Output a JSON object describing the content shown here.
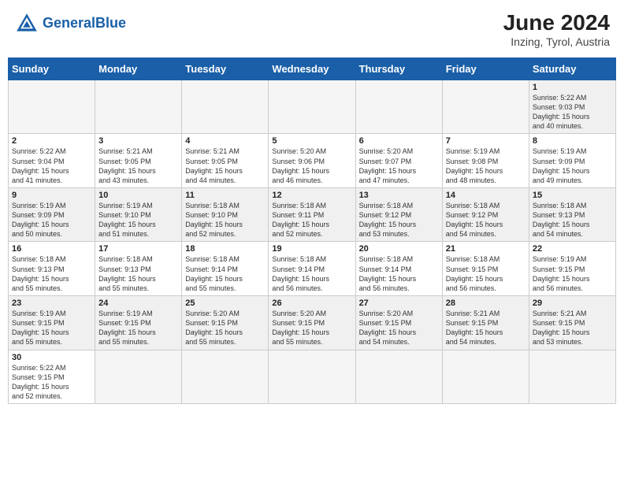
{
  "header": {
    "logo_general": "General",
    "logo_blue": "Blue",
    "month_title": "June 2024",
    "location": "Inzing, Tyrol, Austria"
  },
  "weekdays": [
    "Sunday",
    "Monday",
    "Tuesday",
    "Wednesday",
    "Thursday",
    "Friday",
    "Saturday"
  ],
  "days": [
    {
      "num": "",
      "info": "",
      "empty": true
    },
    {
      "num": "",
      "info": "",
      "empty": true
    },
    {
      "num": "",
      "info": "",
      "empty": true
    },
    {
      "num": "",
      "info": "",
      "empty": true
    },
    {
      "num": "",
      "info": "",
      "empty": true
    },
    {
      "num": "",
      "info": "",
      "empty": true
    },
    {
      "num": "1",
      "info": "Sunrise: 5:22 AM\nSunset: 9:03 PM\nDaylight: 15 hours\nand 40 minutes."
    },
    {
      "num": "2",
      "info": "Sunrise: 5:22 AM\nSunset: 9:04 PM\nDaylight: 15 hours\nand 41 minutes."
    },
    {
      "num": "3",
      "info": "Sunrise: 5:21 AM\nSunset: 9:05 PM\nDaylight: 15 hours\nand 43 minutes."
    },
    {
      "num": "4",
      "info": "Sunrise: 5:21 AM\nSunset: 9:05 PM\nDaylight: 15 hours\nand 44 minutes."
    },
    {
      "num": "5",
      "info": "Sunrise: 5:20 AM\nSunset: 9:06 PM\nDaylight: 15 hours\nand 46 minutes."
    },
    {
      "num": "6",
      "info": "Sunrise: 5:20 AM\nSunset: 9:07 PM\nDaylight: 15 hours\nand 47 minutes."
    },
    {
      "num": "7",
      "info": "Sunrise: 5:19 AM\nSunset: 9:08 PM\nDaylight: 15 hours\nand 48 minutes."
    },
    {
      "num": "8",
      "info": "Sunrise: 5:19 AM\nSunset: 9:09 PM\nDaylight: 15 hours\nand 49 minutes."
    },
    {
      "num": "9",
      "info": "Sunrise: 5:19 AM\nSunset: 9:09 PM\nDaylight: 15 hours\nand 50 minutes."
    },
    {
      "num": "10",
      "info": "Sunrise: 5:19 AM\nSunset: 9:10 PM\nDaylight: 15 hours\nand 51 minutes."
    },
    {
      "num": "11",
      "info": "Sunrise: 5:18 AM\nSunset: 9:10 PM\nDaylight: 15 hours\nand 52 minutes."
    },
    {
      "num": "12",
      "info": "Sunrise: 5:18 AM\nSunset: 9:11 PM\nDaylight: 15 hours\nand 52 minutes."
    },
    {
      "num": "13",
      "info": "Sunrise: 5:18 AM\nSunset: 9:12 PM\nDaylight: 15 hours\nand 53 minutes."
    },
    {
      "num": "14",
      "info": "Sunrise: 5:18 AM\nSunset: 9:12 PM\nDaylight: 15 hours\nand 54 minutes."
    },
    {
      "num": "15",
      "info": "Sunrise: 5:18 AM\nSunset: 9:13 PM\nDaylight: 15 hours\nand 54 minutes."
    },
    {
      "num": "16",
      "info": "Sunrise: 5:18 AM\nSunset: 9:13 PM\nDaylight: 15 hours\nand 55 minutes."
    },
    {
      "num": "17",
      "info": "Sunrise: 5:18 AM\nSunset: 9:13 PM\nDaylight: 15 hours\nand 55 minutes."
    },
    {
      "num": "18",
      "info": "Sunrise: 5:18 AM\nSunset: 9:14 PM\nDaylight: 15 hours\nand 55 minutes."
    },
    {
      "num": "19",
      "info": "Sunrise: 5:18 AM\nSunset: 9:14 PM\nDaylight: 15 hours\nand 56 minutes."
    },
    {
      "num": "20",
      "info": "Sunrise: 5:18 AM\nSunset: 9:14 PM\nDaylight: 15 hours\nand 56 minutes."
    },
    {
      "num": "21",
      "info": "Sunrise: 5:18 AM\nSunset: 9:15 PM\nDaylight: 15 hours\nand 56 minutes."
    },
    {
      "num": "22",
      "info": "Sunrise: 5:19 AM\nSunset: 9:15 PM\nDaylight: 15 hours\nand 56 minutes."
    },
    {
      "num": "23",
      "info": "Sunrise: 5:19 AM\nSunset: 9:15 PM\nDaylight: 15 hours\nand 55 minutes."
    },
    {
      "num": "24",
      "info": "Sunrise: 5:19 AM\nSunset: 9:15 PM\nDaylight: 15 hours\nand 55 minutes."
    },
    {
      "num": "25",
      "info": "Sunrise: 5:20 AM\nSunset: 9:15 PM\nDaylight: 15 hours\nand 55 minutes."
    },
    {
      "num": "26",
      "info": "Sunrise: 5:20 AM\nSunset: 9:15 PM\nDaylight: 15 hours\nand 55 minutes."
    },
    {
      "num": "27",
      "info": "Sunrise: 5:20 AM\nSunset: 9:15 PM\nDaylight: 15 hours\nand 54 minutes."
    },
    {
      "num": "28",
      "info": "Sunrise: 5:21 AM\nSunset: 9:15 PM\nDaylight: 15 hours\nand 54 minutes."
    },
    {
      "num": "29",
      "info": "Sunrise: 5:21 AM\nSunset: 9:15 PM\nDaylight: 15 hours\nand 53 minutes."
    },
    {
      "num": "30",
      "info": "Sunrise: 5:22 AM\nSunset: 9:15 PM\nDaylight: 15 hours\nand 52 minutes."
    },
    {
      "num": "",
      "info": "",
      "empty": true
    },
    {
      "num": "",
      "info": "",
      "empty": true
    },
    {
      "num": "",
      "info": "",
      "empty": true
    },
    {
      "num": "",
      "info": "",
      "empty": true
    },
    {
      "num": "",
      "info": "",
      "empty": true
    },
    {
      "num": "",
      "info": "",
      "empty": true
    }
  ]
}
